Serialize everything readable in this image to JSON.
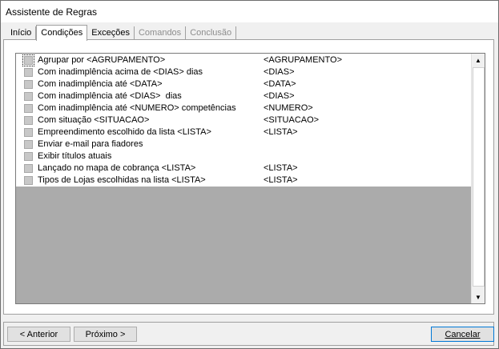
{
  "window": {
    "title": "Assistente de Regras"
  },
  "tabs": [
    {
      "label": "Início",
      "state": "normal"
    },
    {
      "label": "Condições",
      "state": "active"
    },
    {
      "label": "Exceções",
      "state": "normal"
    },
    {
      "label": "Comandos",
      "state": "disabled"
    },
    {
      "label": "Conclusão",
      "state": "disabled"
    }
  ],
  "conditions": [
    {
      "label": "Agrupar por <AGRUPAMENTO>",
      "token": "<AGRUPAMENTO>"
    },
    {
      "label": "Com inadimplência acima de <DIAS> dias",
      "token": "<DIAS>"
    },
    {
      "label": "Com inadimplência até <DATA>",
      "token": "<DATA>"
    },
    {
      "label": "Com inadimplência até <DIAS>  dias",
      "token": "<DIAS>"
    },
    {
      "label": "Com inadimplência até <NUMERO> competências",
      "token": "<NUMERO>"
    },
    {
      "label": "Com situação <SITUACAO>",
      "token": "<SITUACAO>"
    },
    {
      "label": "Empreendimento escolhido da lista <LISTA>",
      "token": "<LISTA>"
    },
    {
      "label": "Enviar e-mail para fiadores",
      "token": ""
    },
    {
      "label": "Exibir títulos atuais",
      "token": ""
    },
    {
      "label": "Lançado no mapa de cobrança <LISTA>",
      "token": "<LISTA>"
    },
    {
      "label": "Tipos de Lojas escolhidas na lista <LISTA>",
      "token": "<LISTA>"
    }
  ],
  "buttons": {
    "previous": "< Anterior",
    "next": "Próximo >",
    "cancel": "Cancelar"
  }
}
